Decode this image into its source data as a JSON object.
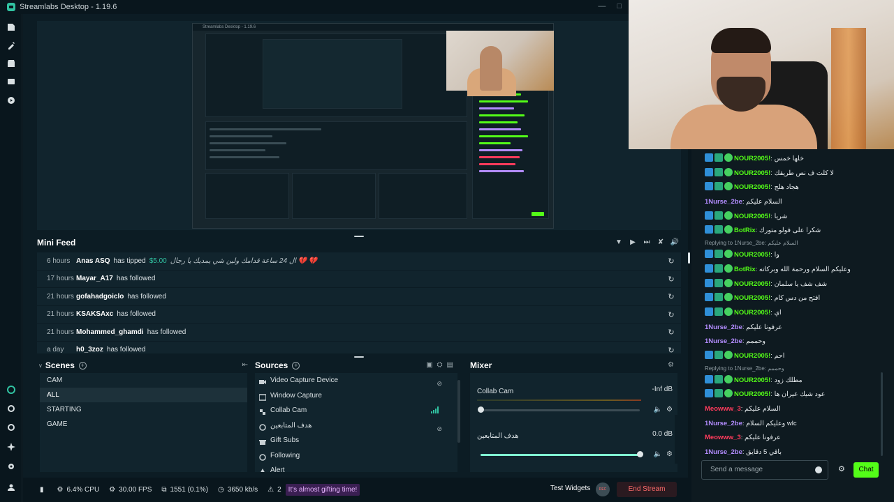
{
  "window": {
    "title": "Streamlabs Desktop - 1.19.6"
  },
  "preview": {
    "mini_title": "Streamlabs Desktop - 1.19.6"
  },
  "minifeed": {
    "title": "Mini Feed",
    "rows": [
      {
        "time": "6 hours",
        "user": "Anas ASQ",
        "action": "has tipped",
        "amount": "$5.00",
        "message": "ال 24 ساعة قدامك ولين شي يمديك يا رجال 💔 💔"
      },
      {
        "time": "17 hours",
        "user": "Mayar_A17",
        "action": "has followed",
        "amount": "",
        "message": ""
      },
      {
        "time": "21 hours",
        "user": "gofahadgoiclo",
        "action": "has followed",
        "amount": "",
        "message": ""
      },
      {
        "time": "21 hours",
        "user": "KSAKSAxc",
        "action": "has followed",
        "amount": "",
        "message": ""
      },
      {
        "time": "21 hours",
        "user": "Mohammed_ghamdi",
        "action": "has followed",
        "amount": "",
        "message": ""
      },
      {
        "time": "a day",
        "user": "h0_3zoz",
        "action": "has followed",
        "amount": "",
        "message": ""
      }
    ]
  },
  "scenes": {
    "title": "Scenes",
    "items": [
      "CAM",
      "ALL",
      "STARTING",
      "GAME"
    ],
    "active_index": 1
  },
  "sources": {
    "title": "Sources",
    "items": [
      "Video Capture Device",
      "Window Capture",
      "Collab Cam",
      "هدف المتابعين",
      "Gift Subs",
      "Following",
      "Alert"
    ]
  },
  "mixer": {
    "title": "Mixer",
    "channels": [
      {
        "name": "Collab Cam",
        "db": "-Inf dB",
        "level": 0.0
      },
      {
        "name": "هدف المتابعين",
        "db": "0.0 dB",
        "level": 1.0
      }
    ]
  },
  "statusbar": {
    "cpu": "6.4% CPU",
    "fps": "30.00 FPS",
    "dropped": "1551 (0.1%)",
    "bitrate": "3650 kb/s",
    "notif_count": "2",
    "notif_text": "It's almost gifting time!",
    "test_widgets": "Test Widgets",
    "rec_label": "REC",
    "end_stream": "End Stream"
  },
  "chat": {
    "lines": [
      {
        "type": "msg",
        "badges": [
          "b1",
          "b2",
          "b3"
        ],
        "nick": "NOUR2005!",
        "color": "#53fc18",
        "text": "خلها خمس"
      },
      {
        "type": "msg",
        "badges": [
          "b1",
          "b2",
          "b3"
        ],
        "nick": "NOUR2005!",
        "color": "#53fc18",
        "text": "لا كلت ف نص طريقك"
      },
      {
        "type": "msg",
        "badges": [
          "b1",
          "b2",
          "b3"
        ],
        "nick": "NOUR2005!",
        "color": "#53fc18",
        "text": "هجاد هلج"
      },
      {
        "type": "msg",
        "badges": [],
        "nick": "1Nurse_2be",
        "color": "#b38cff",
        "text": "السلام عليكم"
      },
      {
        "type": "msg",
        "badges": [
          "b1",
          "b2",
          "b3"
        ],
        "nick": "NOUR2005!",
        "color": "#53fc18",
        "text": "شريا"
      },
      {
        "type": "msg",
        "badges": [
          "b1",
          "b2",
          "b3"
        ],
        "nick": "BotRix",
        "color": "#53fc18",
        "text": "شكرا على فولو متورك"
      },
      {
        "type": "reply",
        "text": "Replying to 1Nurse_2be: السلام عليكم"
      },
      {
        "type": "msg",
        "badges": [
          "b1",
          "b2",
          "b3"
        ],
        "nick": "NOUR2005!",
        "color": "#53fc18",
        "text": "وا"
      },
      {
        "type": "msg",
        "badges": [
          "b1",
          "b2",
          "b3"
        ],
        "nick": "BotRix",
        "color": "#53fc18",
        "text": "وعليكم السلام ورحمة الله وبركاته"
      },
      {
        "type": "msg",
        "badges": [
          "b1",
          "b2",
          "b3"
        ],
        "nick": "NOUR2005!",
        "color": "#53fc18",
        "text": "شف شف يا سلمان"
      },
      {
        "type": "msg",
        "badges": [
          "b1",
          "b2",
          "b3"
        ],
        "nick": "NOUR2005!",
        "color": "#53fc18",
        "text": "افتح من دس كام"
      },
      {
        "type": "msg",
        "badges": [
          "b1",
          "b2",
          "b3"
        ],
        "nick": "NOUR2005!",
        "color": "#53fc18",
        "text": "اي"
      },
      {
        "type": "msg",
        "badges": [],
        "nick": "1Nurse_2be",
        "color": "#b38cff",
        "text": "عرفونا عليكم"
      },
      {
        "type": "msg",
        "badges": [],
        "nick": "1Nurse_2be",
        "color": "#b38cff",
        "text": "وحممم"
      },
      {
        "type": "msg",
        "badges": [
          "b1",
          "b2",
          "b3"
        ],
        "nick": "NOUR2005!",
        "color": "#53fc18",
        "text": "احم"
      },
      {
        "type": "reply",
        "text": "Replying to 1Nurse_2be: وحممم"
      },
      {
        "type": "msg",
        "badges": [
          "b1",
          "b2",
          "b3"
        ],
        "nick": "NOUR2005!",
        "color": "#53fc18",
        "text": "مطلك زود"
      },
      {
        "type": "msg",
        "badges": [
          "b1",
          "b2",
          "b3"
        ],
        "nick": "NOUR2005!",
        "color": "#53fc18",
        "text": "عود شيك عيران ها"
      },
      {
        "type": "msg",
        "badges": [],
        "nick": "Meowww_3",
        "color": "#ff3b5c",
        "text": "السلام عليكم"
      },
      {
        "type": "msg",
        "badges": [],
        "nick": "1Nurse_2be",
        "color": "#b38cff",
        "text": "وعليكم السلام wlc"
      },
      {
        "type": "msg",
        "badges": [],
        "nick": "Meowww_3",
        "color": "#ff3b5c",
        "text": "عرفونا عليكم"
      },
      {
        "type": "msg",
        "badges": [],
        "nick": "1Nurse_2be",
        "color": "#b38cff",
        "text": "باقي 5 دقايق"
      }
    ],
    "input_placeholder": "Send a message",
    "send_label": "Chat"
  }
}
